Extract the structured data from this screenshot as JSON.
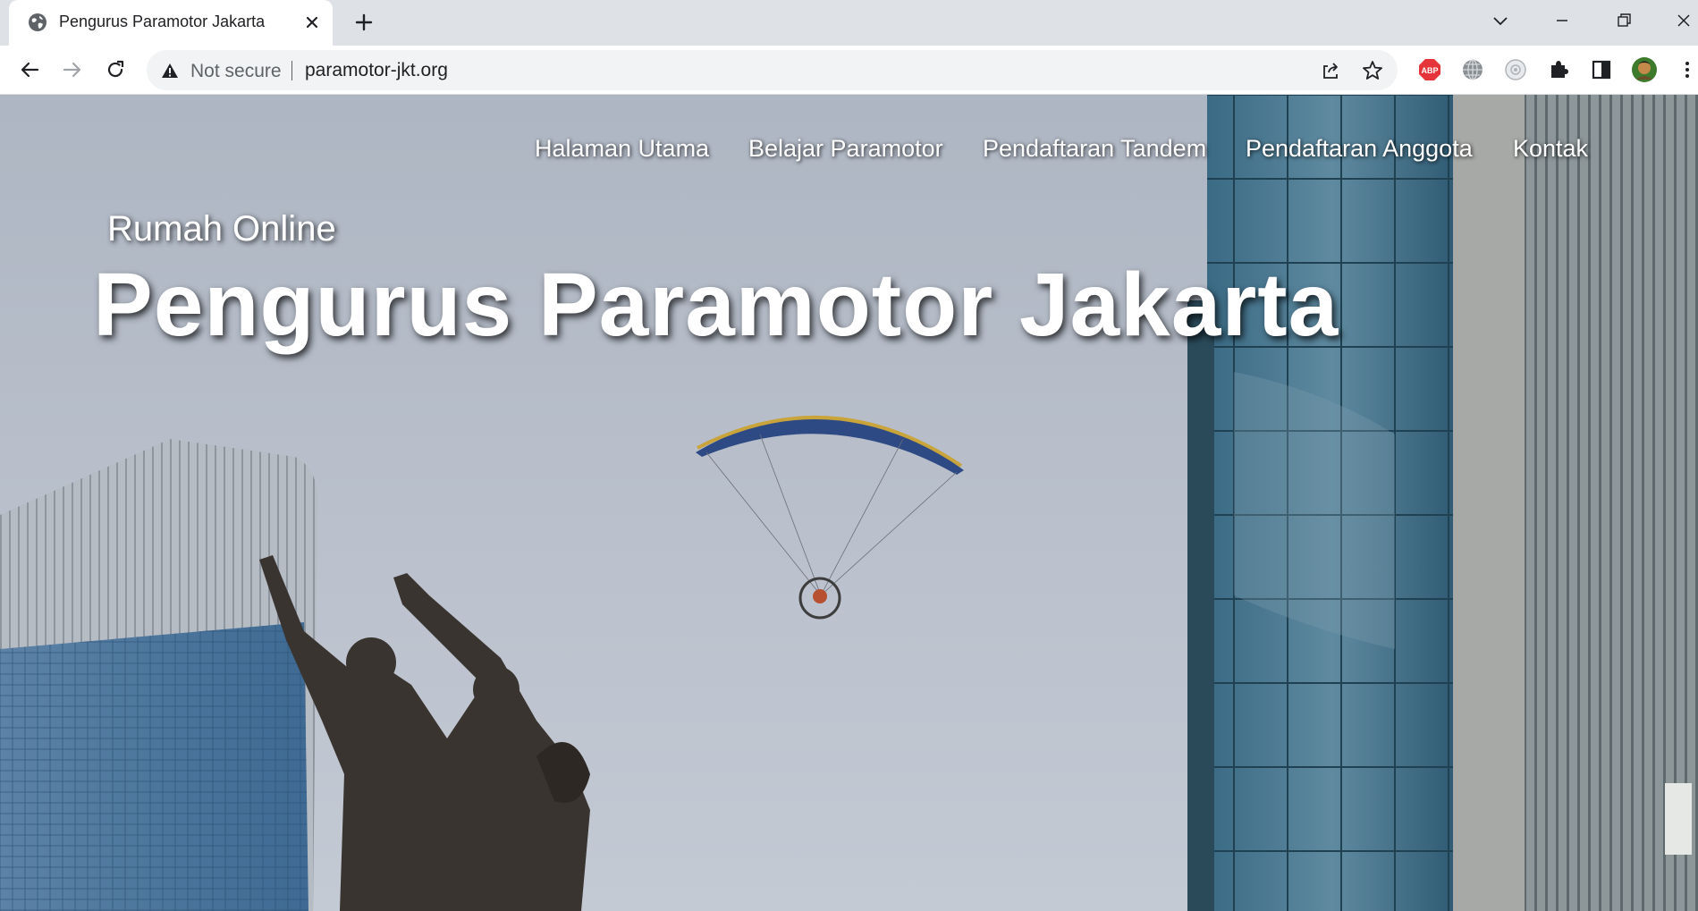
{
  "browser": {
    "tab": {
      "title": "Pengurus Paramotor Jakarta"
    },
    "address_bar": {
      "security_label": "Not secure",
      "url": "paramotor-jkt.org"
    },
    "extensions": [
      "adblock-plus-icon",
      "globe-extension-icon",
      "camera-extension-icon",
      "puzzle-icon",
      "side-panel-icon",
      "profile-avatar"
    ]
  },
  "site": {
    "nav": {
      "items": [
        "Halaman Utama",
        "Belajar Paramotor",
        "Pendaftaran Tandem",
        "Pendaftaran Anggota",
        "Kontak"
      ]
    },
    "hero": {
      "subtitle": "Rumah Online",
      "title": "Pengurus Paramotor Jakarta"
    }
  },
  "colors": {
    "sky": "#b8c0cc",
    "nav_text": "#ffffff",
    "tab_strip": "#dee1e6",
    "omnibox_bg": "#f1f3f4",
    "abp_red": "#e5343a"
  }
}
